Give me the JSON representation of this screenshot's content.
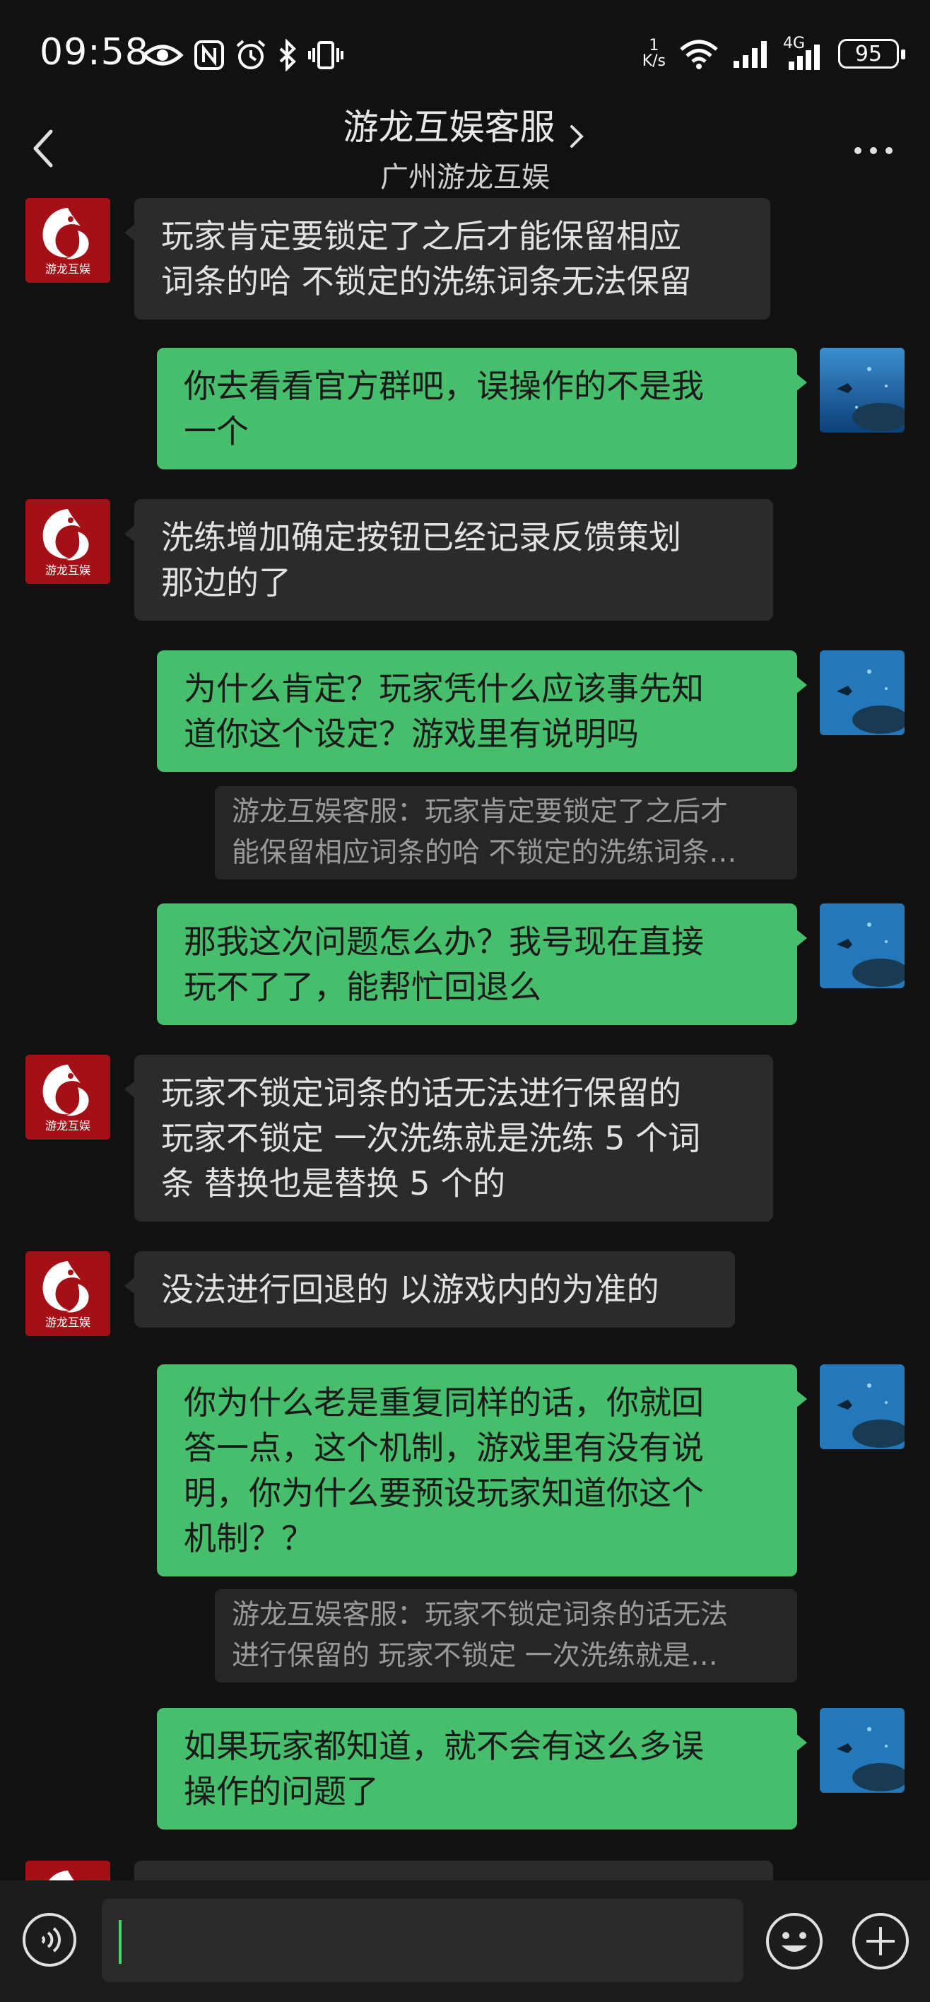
{
  "status_bar": {
    "time": "09:58",
    "net_speed_value": "1",
    "net_speed_unit": "K/s",
    "network": "4G",
    "battery": "95"
  },
  "header": {
    "title": "游龙互娱客服",
    "subtitle": "广州游龙互娱"
  },
  "avatars": {
    "cs_logo_text": "游龙互娱"
  },
  "messages": [
    {
      "from": "cs",
      "lines": [
        "玩家肯定要锁定了之后才能保留相应",
        "词条的哈 不锁定的洗练词条无法保留"
      ]
    },
    {
      "from": "me",
      "lines": [
        "你去看看官方群吧，误操作的不是我",
        "一个"
      ]
    },
    {
      "from": "cs",
      "lines": [
        "洗练增加确定按钮已经记录反馈策划",
        "那边的了"
      ]
    },
    {
      "from": "me",
      "lines": [
        "为什么肯定？玩家凭什么应该事先知",
        "道你这个设定？游戏里有说明吗"
      ],
      "quote": [
        "游龙互娱客服：玩家肯定要锁定了之后才",
        "能保留相应词条的哈 不锁定的洗练词条…"
      ]
    },
    {
      "from": "me",
      "lines": [
        "那我这次问题怎么办？我号现在直接",
        "玩不了了，能帮忙回退么"
      ]
    },
    {
      "from": "cs",
      "lines": [
        "玩家不锁定词条的话无法进行保留的",
        "玩家不锁定 一次洗练就是洗练 5 个词",
        "条 替换也是替换 5 个的"
      ]
    },
    {
      "from": "cs",
      "lines": [
        "没法进行回退的 以游戏内的为准的"
      ]
    },
    {
      "from": "me",
      "lines": [
        "你为什么老是重复同样的话，你就回",
        "答一点，这个机制，游戏里有没有说",
        "明，你为什么要预设玩家知道你这个",
        "机制？？"
      ],
      "quote": [
        "游龙互娱客服：玩家不锁定词条的话无法",
        "进行保留的 玩家不锁定 一次洗练就是…"
      ]
    },
    {
      "from": "me",
      "lines": [
        "如果玩家都知道，就不会有这么多误",
        "操作的问题了"
      ]
    }
  ],
  "input": {
    "value": "",
    "placeholder": ""
  }
}
